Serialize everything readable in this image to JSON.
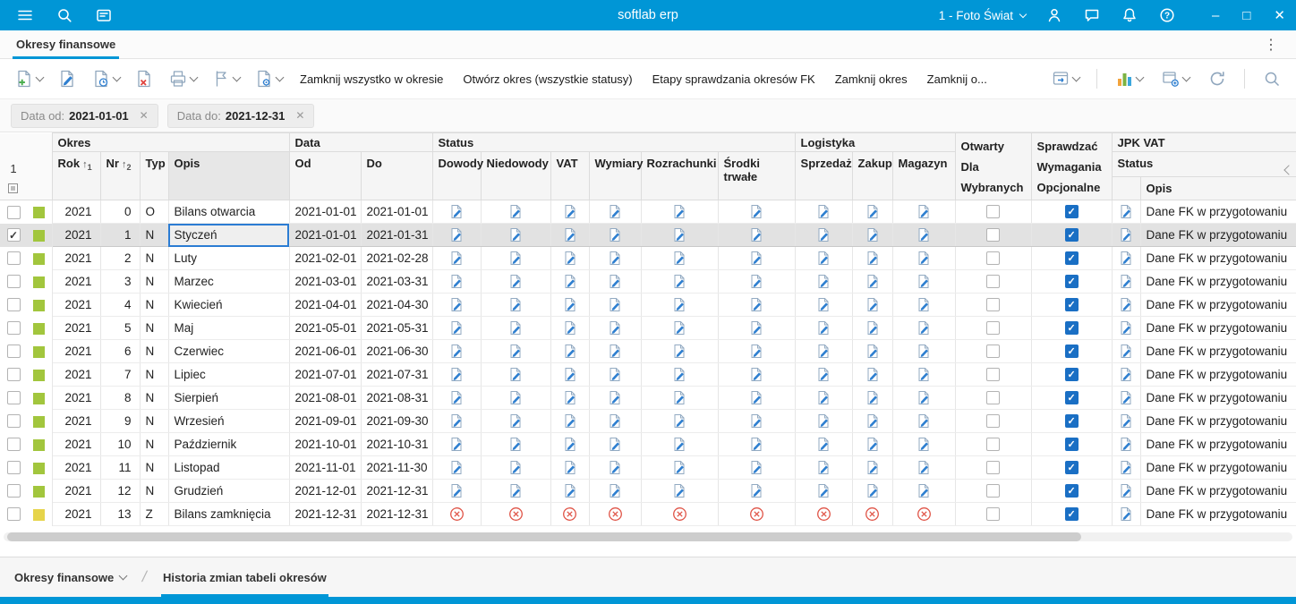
{
  "topbar": {
    "title": "softlab erp",
    "company": "1 - Foto Świat"
  },
  "tabbar": {
    "active_tab": "Okresy finansowe"
  },
  "toolbar": {
    "text_buttons": [
      "Zamknij wszystko w okresie",
      "Otwórz okres (wszystkie statusy)",
      "Etapy sprawdzania okresów FK",
      "Zamknij okres",
      "Zamknij o..."
    ]
  },
  "filters": {
    "chips": [
      {
        "label": "Data od:",
        "value": "2021-01-01",
        "remove": "✕"
      },
      {
        "label": "Data do:",
        "value": "2021-12-31",
        "remove": "✕"
      }
    ]
  },
  "table": {
    "row_number": "1",
    "groups": {
      "okres": "Okres",
      "data": "Data",
      "status": "Status",
      "logistyka": "Logistyka",
      "otwarty": "Otwarty",
      "sprawdzac": "Sprawdzać",
      "jpk": "JPK VAT"
    },
    "columns": {
      "rok": "Rok",
      "nr": "Nr",
      "typ": "Typ",
      "opis": "Opis",
      "od": "Od",
      "do": "Do",
      "dowody": "Dowody",
      "niedowody": "Niedowody",
      "vat": "VAT",
      "wymiary": "Wymiary",
      "rozrachunki": "Rozrachunki",
      "srodki_trwale": "Środki trwałe",
      "sprzedaz": "Sprzedaż",
      "zakup": "Zakup",
      "magazyn": "Magazyn",
      "otwarty_dla": "Dla",
      "otwarty_wybranych": "Wybranych",
      "sprawdzac_wymagania": "Wymagania",
      "sprawdzac_opcjonalne": "Opcjonalne",
      "jpk_status": "Status",
      "jpk_opis": "Opis"
    },
    "sort": {
      "rok": "1",
      "nr": "2"
    },
    "row_defaults": {
      "status": "edit",
      "color": "green",
      "checked": false,
      "selected": false,
      "otwarty_checked": false,
      "sprawdzac_checked": true,
      "jpk_opis": "Dane FK w przygotowaniu"
    },
    "rows": [
      {
        "rok": "2021",
        "nr": "0",
        "typ": "O",
        "opis": "Bilans otwarcia",
        "od": "2021-01-01",
        "do": "2021-01-01"
      },
      {
        "rok": "2021",
        "nr": "1",
        "typ": "N",
        "opis": "Styczeń",
        "od": "2021-01-01",
        "do": "2021-01-31",
        "checked": true,
        "selected": true
      },
      {
        "rok": "2021",
        "nr": "2",
        "typ": "N",
        "opis": "Luty",
        "od": "2021-02-01",
        "do": "2021-02-28"
      },
      {
        "rok": "2021",
        "nr": "3",
        "typ": "N",
        "opis": "Marzec",
        "od": "2021-03-01",
        "do": "2021-03-31"
      },
      {
        "rok": "2021",
        "nr": "4",
        "typ": "N",
        "opis": "Kwiecień",
        "od": "2021-04-01",
        "do": "2021-04-30"
      },
      {
        "rok": "2021",
        "nr": "5",
        "typ": "N",
        "opis": "Maj",
        "od": "2021-05-01",
        "do": "2021-05-31"
      },
      {
        "rok": "2021",
        "nr": "6",
        "typ": "N",
        "opis": "Czerwiec",
        "od": "2021-06-01",
        "do": "2021-06-30"
      },
      {
        "rok": "2021",
        "nr": "7",
        "typ": "N",
        "opis": "Lipiec",
        "od": "2021-07-01",
        "do": "2021-07-31"
      },
      {
        "rok": "2021",
        "nr": "8",
        "typ": "N",
        "opis": "Sierpień",
        "od": "2021-08-01",
        "do": "2021-08-31"
      },
      {
        "rok": "2021",
        "nr": "9",
        "typ": "N",
        "opis": "Wrzesień",
        "od": "2021-09-01",
        "do": "2021-09-30"
      },
      {
        "rok": "2021",
        "nr": "10",
        "typ": "N",
        "opis": "Październik",
        "od": "2021-10-01",
        "do": "2021-10-31"
      },
      {
        "rok": "2021",
        "nr": "11",
        "typ": "N",
        "opis": "Listopad",
        "od": "2021-11-01",
        "do": "2021-11-30"
      },
      {
        "rok": "2021",
        "nr": "12",
        "typ": "N",
        "opis": "Grudzień",
        "od": "2021-12-01",
        "do": "2021-12-31"
      },
      {
        "rok": "2021",
        "nr": "13",
        "typ": "Z",
        "opis": "Bilans zamknięcia",
        "od": "2021-12-31",
        "do": "2021-12-31",
        "status": "blocked",
        "color": "yellow"
      }
    ]
  },
  "footer": {
    "left_tab": "Okresy finansowe",
    "active_tab": "Historia zmian tabeli okresów"
  },
  "icons": {
    "sort_asc": "↑",
    "dots_menu": "⋮",
    "minimize": "–",
    "maximize": "□",
    "close": "✕",
    "help": "?"
  },
  "colors": {
    "accent_blue": "#0096d6",
    "checkbox_blue": "#1a6fc4",
    "period_green": "#a2c63d",
    "period_yellow": "#e6d44a",
    "blocked_red": "#e05548",
    "edit_icon_blue": "#2e7fd0"
  }
}
